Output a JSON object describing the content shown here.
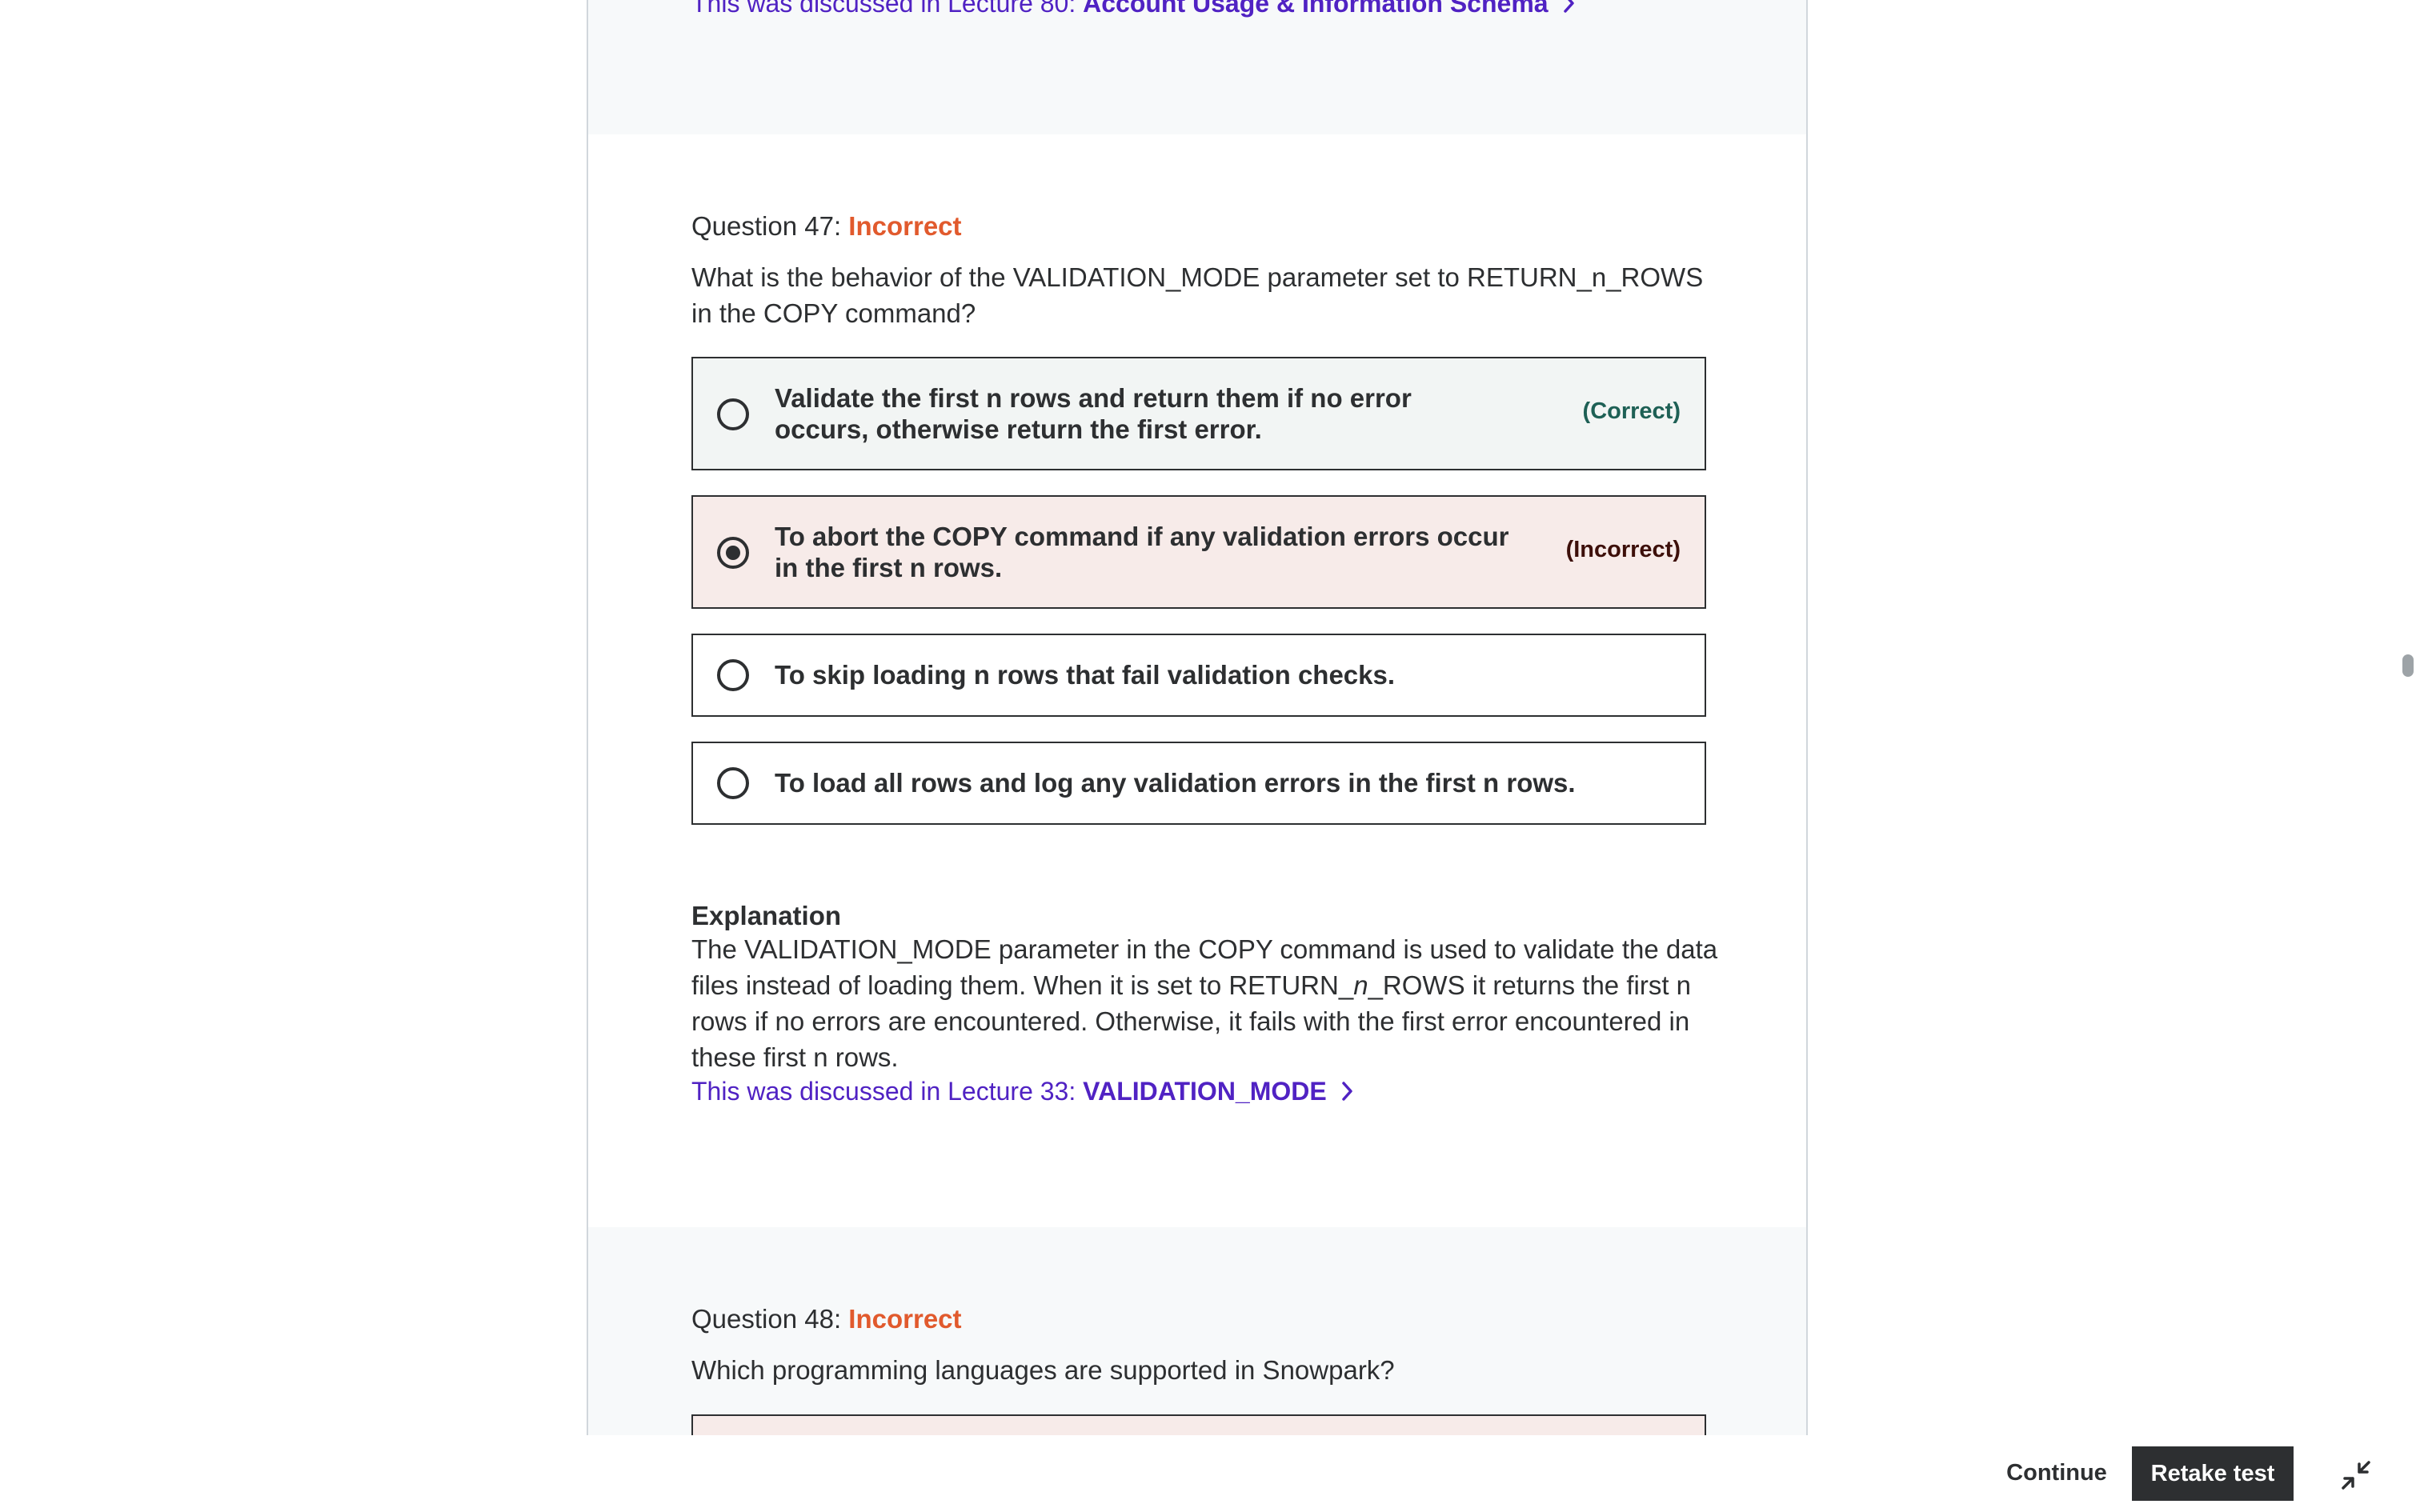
{
  "previous": {
    "ref_prefix": "This was discussed in Lecture 80: ",
    "ref_link": "Account Usage & Information Schema"
  },
  "q47": {
    "label": "Question 47: ",
    "status": "Incorrect",
    "text": "What is the behavior of the VALIDATION_MODE parameter set to RETURN_n_ROWS in the COPY command?",
    "options": [
      {
        "text": "Validate the first n rows and return them if no error occurs, otherwise return the first error.",
        "tag": "(Correct)",
        "selected": false
      },
      {
        "text": "To abort the COPY command if any validation errors occur in the first n rows.",
        "tag": "(Incorrect)",
        "selected": true
      },
      {
        "text": "To skip loading n rows that fail validation checks.",
        "tag": "",
        "selected": false
      },
      {
        "text": "To load all rows and log any validation errors in the first n rows.",
        "tag": "",
        "selected": false
      }
    ],
    "explanation_title": "Explanation",
    "explanation_part1": "The VALIDATION_MODE parameter in the COPY command is used to validate the data files instead of loading them. When it is set to RETURN_",
    "explanation_italic": "n",
    "explanation_part2": "_ROWS it returns the first n rows if no errors are encountered. Otherwise, it fails with the first error encountered in these first n rows.",
    "ref_prefix": "This was discussed in Lecture 33: ",
    "ref_link": "VALIDATION_MODE"
  },
  "q48": {
    "label": "Question 48: ",
    "status": "Incorrect",
    "text": "Which programming languages are supported in Snowpark?"
  },
  "footer": {
    "continue_label": "Continue",
    "retake_label": "Retake test"
  }
}
